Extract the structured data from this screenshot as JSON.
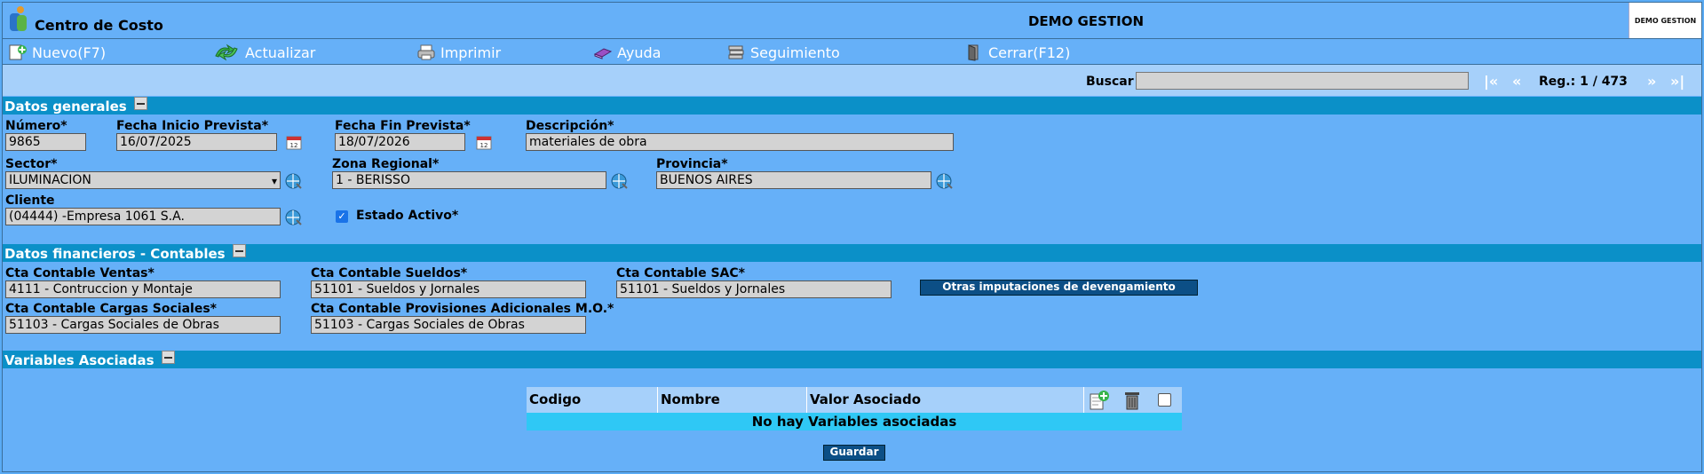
{
  "header": {
    "app_title": "Centro de Costo",
    "company": "DEMO GESTION",
    "corner_logo_text": "DEMO GESTION"
  },
  "toolbar": {
    "new_label": "Nuevo(F7)",
    "update_label": "Actualizar",
    "print_label": "Imprimir",
    "help_label": "Ayuda",
    "tracking_label": "Seguimiento",
    "close_label": "Cerrar(F12)"
  },
  "navbar": {
    "search_label": "Buscar",
    "search_value": "",
    "first": "|«",
    "prev": "«",
    "reg_text": "Reg.: 1 / 473",
    "next": "»",
    "last": "»|"
  },
  "general": {
    "title": "Datos generales",
    "numero_label": "Número*",
    "numero_value": "9865",
    "fecha_inicio_label": "Fecha Inicio Prevista*",
    "fecha_inicio_value": "16/07/2025",
    "fecha_fin_label": "Fecha Fin Prevista*",
    "fecha_fin_value": "18/07/2026",
    "descripcion_label": "Descripción*",
    "descripcion_value": " materiales de obra",
    "sector_label": "Sector*",
    "sector_value": "ILUMINACION",
    "zona_label": "Zona Regional*",
    "zona_value": "1 - BERISSO",
    "provincia_label": "Provincia*",
    "provincia_value": "BUENOS AIRES",
    "cliente_label": "Cliente",
    "cliente_value": "(04444) -Empresa 1061 S.A.",
    "estado_label": "Estado Activo*",
    "estado_checked": true
  },
  "financial": {
    "title": "Datos financieros - Contables",
    "ventas_label": "Cta Contable Ventas*",
    "ventas_value": "4111 - Contruccion y Montaje",
    "sueldos_label": "Cta Contable Sueldos*",
    "sueldos_value": "51101 - Sueldos y Jornales",
    "sac_label": "Cta Contable SAC*",
    "sac_value": "51101 - Sueldos y Jornales",
    "otras_button": "Otras imputaciones de devengamiento",
    "cargas_label": "Cta Contable Cargas Sociales*",
    "cargas_value": "51103 - Cargas Sociales de Obras",
    "provisiones_label": "Cta Contable Provisiones Adicionales M.O.*",
    "provisiones_value": "51103 - Cargas Sociales de Obras"
  },
  "variables": {
    "title": "Variables Asociadas",
    "col_codigo": "Codigo",
    "col_nombre": "Nombre",
    "col_valor": "Valor Asociado",
    "empty_message": "No hay Variables asociadas",
    "save_button": "Guardar"
  }
}
